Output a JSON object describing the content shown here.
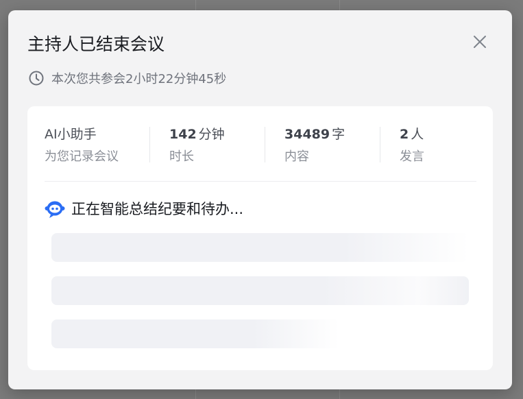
{
  "dialog": {
    "title": "主持人已结束会议",
    "duration_text": "本次您共参会2小时22分钟45秒",
    "icons": {
      "clock": "clock-icon",
      "close": "close-icon",
      "assistant": "ai-bot-icon"
    }
  },
  "stats": [
    {
      "title": "AI小助手",
      "value": "",
      "unit": "",
      "label": "为您记录会议"
    },
    {
      "title": "",
      "value": "142",
      "unit": "分钟",
      "label": "时长"
    },
    {
      "title": "",
      "value": "34489",
      "unit": "字",
      "label": "内容"
    },
    {
      "title": "",
      "value": "2",
      "unit": "人",
      "label": "发言"
    }
  ],
  "summary": {
    "status_text": "正在智能总结纪要和待办..."
  },
  "colors": {
    "accent": "#2a6df4",
    "overlay": "#7b7b7b",
    "dialog_bg": "#f3f3f4",
    "card_bg": "#ffffff",
    "skeleton": "#f0f1f5"
  }
}
